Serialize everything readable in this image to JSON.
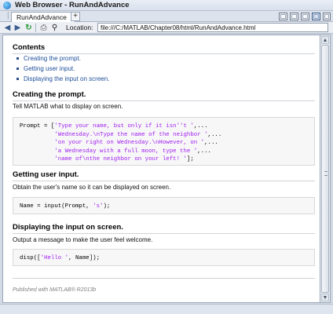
{
  "window": {
    "title": "Web Browser - RunAndAdvance"
  },
  "tabs": [
    {
      "label": "RunAndAdvance"
    }
  ],
  "toolbar": {
    "location_label": "Location:",
    "location_value": "file:///C:/MATLAB/Chapter08/html/RunAndAdvance.html",
    "icons": [
      "back-icon",
      "forward-icon",
      "refresh-icon",
      "print-icon",
      "find-icon"
    ]
  },
  "page": {
    "contents_heading": "Contents",
    "toc": [
      {
        "label": "Creating the prompt."
      },
      {
        "label": "Getting user input."
      },
      {
        "label": "Displaying the input on screen."
      }
    ],
    "sections": [
      {
        "heading": "Creating the prompt.",
        "description": "Tell MATLAB what to display on screen.",
        "code": [
          {
            "pre": "Prompt = [",
            "str": "'Type your name, but only if it isn''t '",
            "post": ",..."
          },
          {
            "pre": "          ",
            "str": "'Wednesday.\\nType the name of the neighbor '",
            "post": ",..."
          },
          {
            "pre": "          ",
            "str": "'on your right on Wednesday.\\nHowever, on '",
            "post": ",..."
          },
          {
            "pre": "          ",
            "str": "'a Wednesday with a full moon, type the '",
            "post": ",..."
          },
          {
            "pre": "          ",
            "str": "'name of\\nthe neighbor on your left! '",
            "post": "];"
          }
        ]
      },
      {
        "heading": "Getting user input.",
        "description": "Obtain the user's name so it can be displayed on screen.",
        "code": [
          {
            "pre": "Name = input(Prompt, ",
            "str": "'s'",
            "post": ");"
          }
        ]
      },
      {
        "heading": "Displaying the input on screen.",
        "description": "Output a message to make the user feel welcome.",
        "code": [
          {
            "pre": "disp([",
            "str": "'Hello '",
            "post": ", Name]);"
          }
        ]
      }
    ],
    "footer": "Published with MATLAB® R2013b"
  }
}
